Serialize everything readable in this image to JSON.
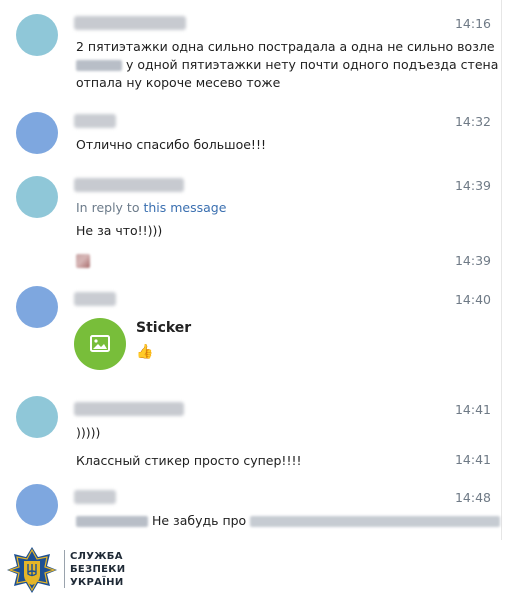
{
  "messages": [
    {
      "time": "14:16",
      "line1": "2 пятиэтажки одна сильно пострадала а одна не сильно возле",
      "line2": "у одной пятиэтажки нету почти одного подъезда стена",
      "line3": "отпала ну короче месево тоже"
    },
    {
      "time": "14:32",
      "text": "Отлично спасибо большое!!!"
    },
    {
      "time": "14:39",
      "reply_prefix": "In reply to",
      "reply_link": "this message",
      "text": "Не за что!!)))",
      "followup_time": "14:39"
    },
    {
      "time": "14:40",
      "sticker_label": "Sticker",
      "sticker_emoji": "👍"
    },
    {
      "time": "14:41",
      "text": ")))))",
      "followup_text": "Классный стикер просто супер!!!!",
      "followup_time": "14:41"
    },
    {
      "time": "14:48",
      "text": "Не забудь про"
    }
  ],
  "logo": {
    "line1": "СЛУЖБА",
    "line2": "БЕЗПЕКИ",
    "line3": "УКРАЇНИ"
  },
  "colors": {
    "avatar_teal": "#8fc7d8",
    "avatar_blue": "#7ea7df",
    "sticker_green": "#78be3a",
    "link": "#3a6fb0",
    "time": "#6f7a86",
    "logo_blue": "#1c4f93",
    "logo_gold": "#e5b528"
  }
}
